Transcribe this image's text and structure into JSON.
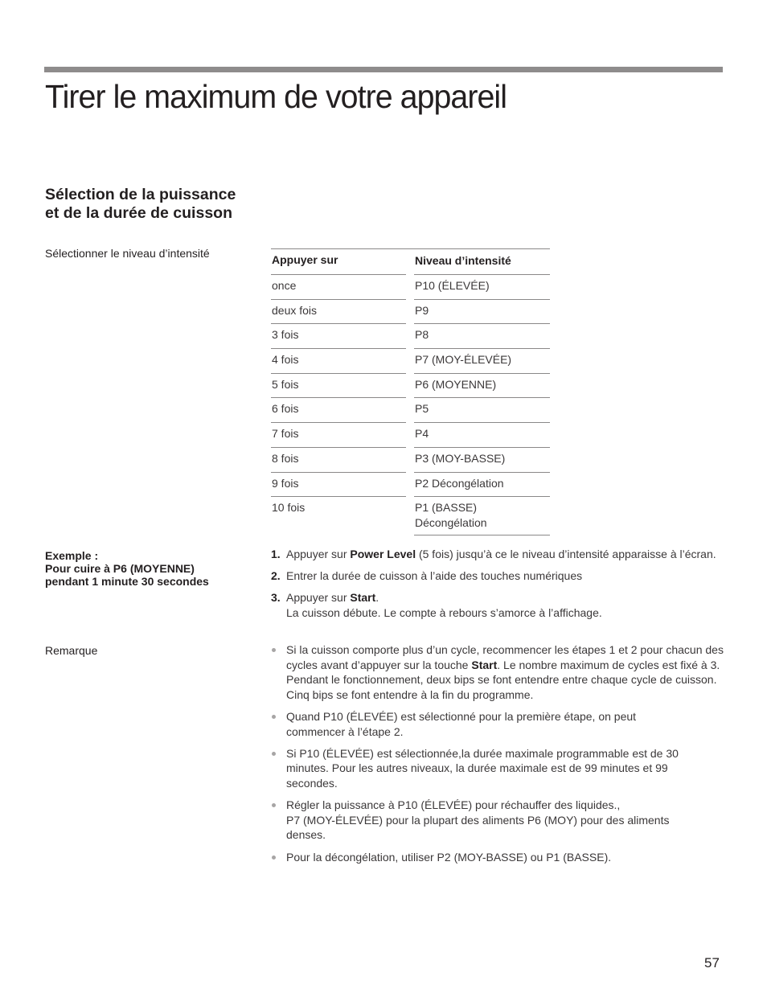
{
  "page": {
    "title": "Tirer le maximum de votre appareil",
    "number": "57"
  },
  "section": {
    "heading": "Sélection de la puissance et de la durée de cuisson",
    "subheading": "Sélectionner le niveau d’intensité"
  },
  "table": {
    "headers": [
      "Appuyer sur",
      "Niveau d’intensité"
    ],
    "rows": [
      {
        "press": "once",
        "level": "P10 (ÉLEVÉE)"
      },
      {
        "press": "deux fois",
        "level": "P9"
      },
      {
        "press": "3 fois",
        "level": "P8"
      },
      {
        "press": "4 fois",
        "level": "P7 (MOY-ÉLEVÉE)"
      },
      {
        "press": "5 fois",
        "level": "P6 (MOYENNE)"
      },
      {
        "press": "6 fois",
        "level": "P5"
      },
      {
        "press": "7 fois",
        "level": "P4"
      },
      {
        "press": "8 fois",
        "level": "P3 (MOY-BASSE)"
      },
      {
        "press": "9 fois",
        "level": "P2 Décongélation"
      },
      {
        "press": "10 fois",
        "level_line1": "P1 (BASSE)",
        "level_line2": "Décongélation"
      }
    ]
  },
  "example": {
    "label_line1": "Exemple :",
    "label_line2": "Pour cuire à P6 (MOYENNE)",
    "label_line3": "pendant 1 minute 30 secondes",
    "steps": [
      {
        "num": "1.",
        "pre": "Appuyer sur ",
        "bold": "Power Level",
        "post": " (5 fois) jusqu’à ce le niveau d’intensité apparaisse à l’écran."
      },
      {
        "num": "2.",
        "text": "Entrer la durée de cuisson à l’aide des touches numériques"
      },
      {
        "num": "3.",
        "pre": "Appuyer sur ",
        "bold": "Start",
        "post": ".",
        "line2": "La cuisson débute. Le compte à rebours s’amorce à l’affichage."
      }
    ]
  },
  "remark": {
    "label": "Remarque",
    "items": [
      {
        "pre": "Si la cuisson comporte plus d’un cycle, recommencer les étapes 1 et 2 pour chacun des cycles avant d’appuyer sur la touche ",
        "bold": "Start",
        "post": ". Le nombre maximum de cycles est fixé à 3. Pendant le fonctionnement, deux bips se font entendre entre chaque cycle de cuisson. Cinq bips se font entendre à la fin du programme."
      },
      {
        "text": "Quand P10 (ÉLEVÉE) est sélectionné pour la première étape, on peut commencer à l’étape 2."
      },
      {
        "text": "Si P10 (ÉLEVÉE) est sélectionnée,la durée maximale programmable est de 30 minutes. Pour les autres niveaux, la durée maximale est de 99 minutes et 99 secondes."
      },
      {
        "line1": "Régler la puissance à P10 (ÉLEVÉE) pour réchauffer des liquides.,",
        "line2": "P7 (MOY-ÉLEVÉE) pour la plupart des aliments P6 (MOY) pour des aliments denses."
      },
      {
        "text": "Pour la décongélation, utiliser P2 (MOY-BASSE) ou P1 (BASSE)."
      }
    ]
  }
}
